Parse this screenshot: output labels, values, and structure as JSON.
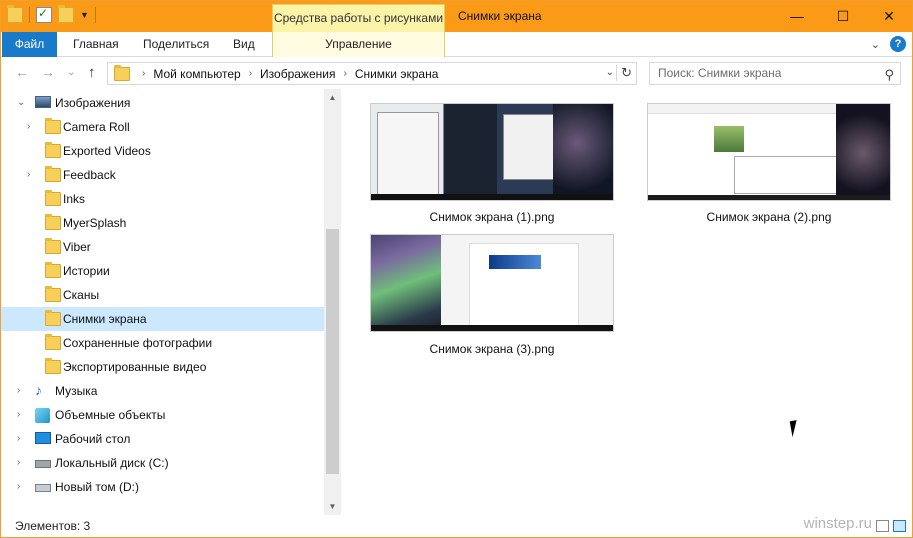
{
  "titlebar": {
    "context_tab": "Средства работы с рисунками",
    "title": "Снимки экрана",
    "minimize": "—",
    "maximize": "☐",
    "close": "✕"
  },
  "ribbon": {
    "tabs": [
      "Файл",
      "Главная",
      "Поделиться",
      "Вид",
      "Управление"
    ],
    "expand_chevron": "⌄",
    "help": "?"
  },
  "nav": {
    "back": "←",
    "forward": "→",
    "recent": "⌄",
    "up": "↑",
    "breadcrumb": [
      "Мой компьютер",
      "Изображения",
      "Снимки экрана"
    ],
    "crumb_sep": "›",
    "dropdown": "⌄",
    "refresh": "↻",
    "search_placeholder": "Поиск: Снимки экрана",
    "search_icon": "⚲"
  },
  "tree": [
    {
      "label": "Изображения",
      "level": 0,
      "arrow": "⌄",
      "icon": "pictures-icon"
    },
    {
      "label": "Camera Roll",
      "level": 1,
      "arrow": "›",
      "icon": "folder-icon"
    },
    {
      "label": "Exported Videos",
      "level": 1,
      "arrow": "",
      "icon": "folder-icon"
    },
    {
      "label": "Feedback",
      "level": 1,
      "arrow": "›",
      "icon": "folder-icon"
    },
    {
      "label": "Inks",
      "level": 1,
      "arrow": "",
      "icon": "folder-icon"
    },
    {
      "label": "MyerSplash",
      "level": 1,
      "arrow": "",
      "icon": "folder-icon"
    },
    {
      "label": "Viber",
      "level": 1,
      "arrow": "",
      "icon": "folder-icon"
    },
    {
      "label": "Истории",
      "level": 1,
      "arrow": "",
      "icon": "folder-icon"
    },
    {
      "label": "Сканы",
      "level": 1,
      "arrow": "",
      "icon": "folder-icon"
    },
    {
      "label": "Снимки экрана",
      "level": 1,
      "arrow": "",
      "icon": "folder-icon",
      "selected": true
    },
    {
      "label": "Сохраненные фотографии",
      "level": 1,
      "arrow": "",
      "icon": "folder-icon"
    },
    {
      "label": "Экспортированные видео",
      "level": 1,
      "arrow": "",
      "icon": "folder-icon"
    },
    {
      "label": "Музыка",
      "level": 0,
      "arrow": "›",
      "icon": "music-icon"
    },
    {
      "label": "Объемные объекты",
      "level": 0,
      "arrow": "›",
      "icon": "3d-objects-icon"
    },
    {
      "label": "Рабочий стол",
      "level": 0,
      "arrow": "›",
      "icon": "desktop-icon"
    },
    {
      "label": "Локальный диск (C:)",
      "level": 0,
      "arrow": "›",
      "icon": "local-disk-icon"
    },
    {
      "label": "Новый том (D:)",
      "level": 0,
      "arrow": "›",
      "icon": "drive-icon"
    }
  ],
  "scroll": {
    "up": "▲",
    "down": "▼"
  },
  "files": [
    {
      "name": "Снимок экрана (1).png"
    },
    {
      "name": "Снимок экрана (2).png"
    },
    {
      "name": "Снимок экрана (3).png"
    }
  ],
  "status": {
    "items": "Элементов: 3",
    "watermark": "winstep.ru"
  }
}
